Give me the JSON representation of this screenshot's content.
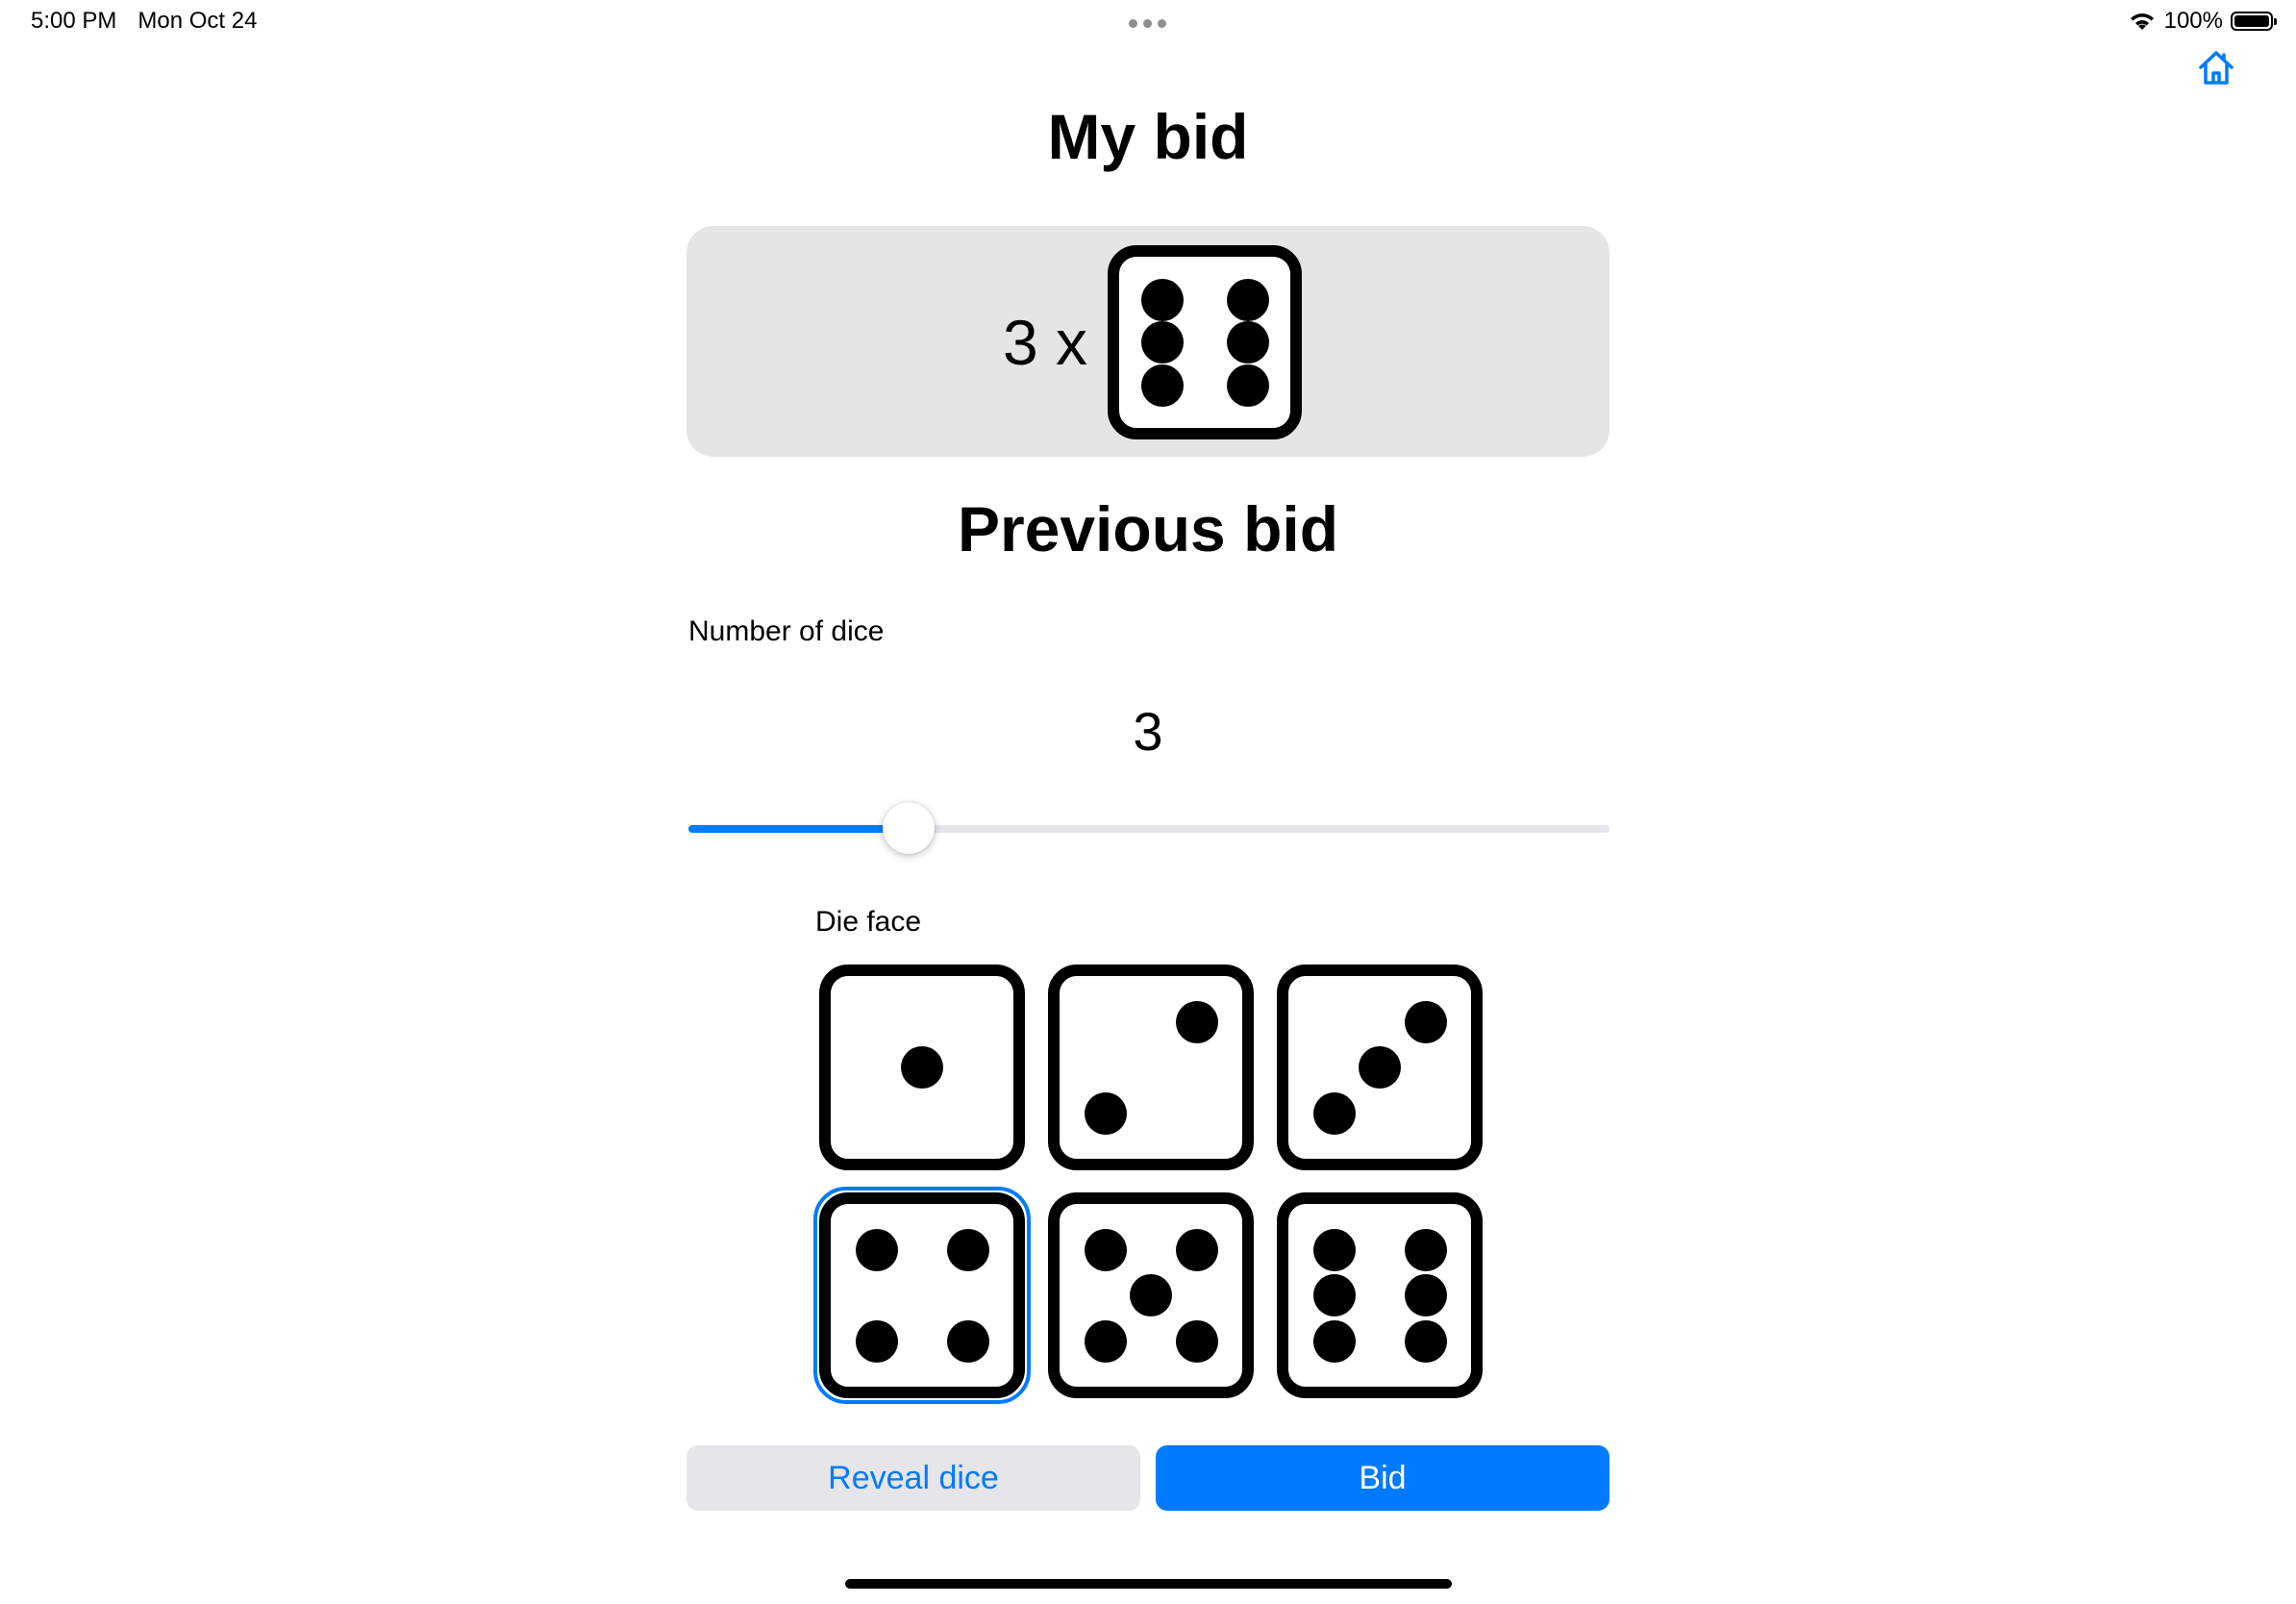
{
  "status_bar": {
    "time": "5:00 PM",
    "date": "Mon Oct 24",
    "battery": "100%"
  },
  "icons": {
    "home": "home-icon",
    "wifi": "wifi-icon",
    "battery": "battery-icon"
  },
  "my_bid": {
    "title": "My bid",
    "count_text": "3 x",
    "face": 6
  },
  "previous_bid": {
    "title": "Previous bid"
  },
  "number_of_dice": {
    "label": "Number of dice",
    "value": "3"
  },
  "die_face": {
    "label": "Die face",
    "options": [
      1,
      2,
      3,
      4,
      5,
      6
    ],
    "selected": 4
  },
  "buttons": {
    "reveal": "Reveal dice",
    "bid": "Bid"
  },
  "colors": {
    "accent": "#007aff",
    "card_bg": "#e5e5e5"
  }
}
